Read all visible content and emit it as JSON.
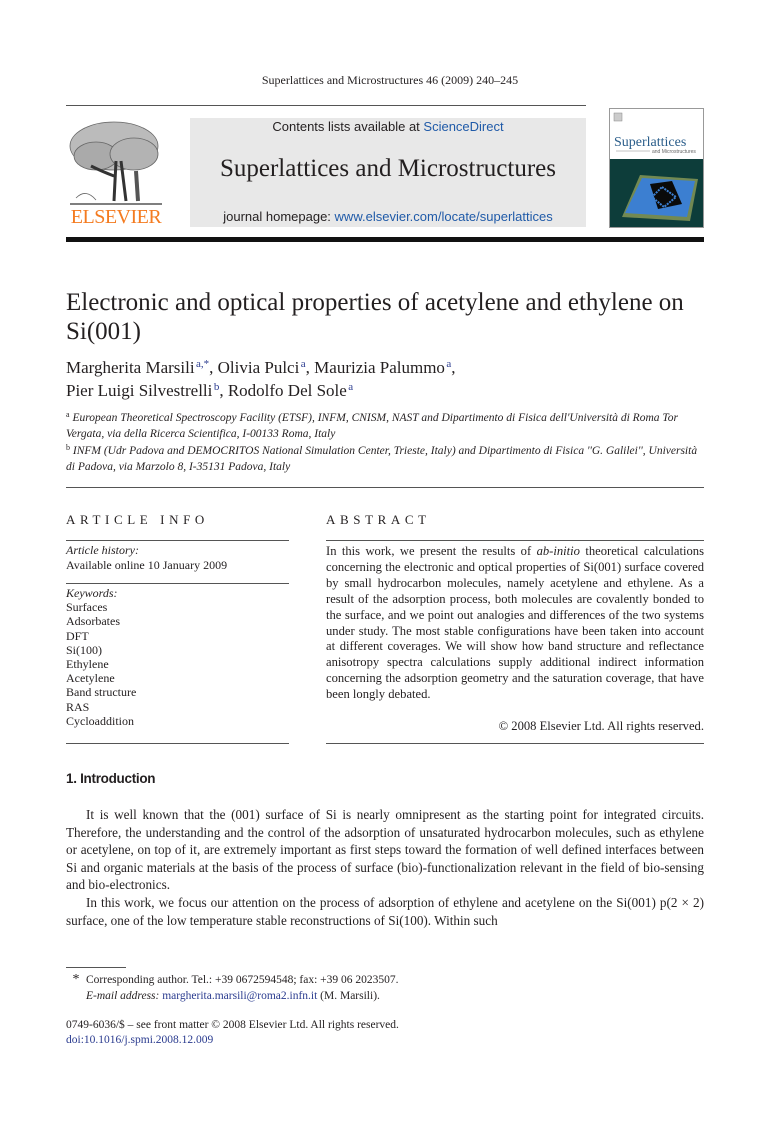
{
  "running_head": "Superlattices and Microstructures 46 (2009) 240–245",
  "masthead": {
    "publisher_logo_text": "ELSEVIER",
    "contents_prefix": "Contents lists available at ",
    "contents_link": "ScienceDirect",
    "journal_name": "Superlattices and Microstructures",
    "homepage_prefix": "journal homepage: ",
    "homepage_link": "www.elsevier.com/locate/superlattices",
    "cover_title": "Superlattices",
    "cover_subtitle": "and Microstructures"
  },
  "article": {
    "title": "Electronic and optical properties of acetylene and ethylene on Si(001)",
    "authors": [
      {
        "name": "Margherita Marsili",
        "aff": "a,*"
      },
      {
        "name": "Olivia Pulci",
        "aff": "a"
      },
      {
        "name": "Maurizia Palummo",
        "aff": "a"
      },
      {
        "name": "Pier Luigi Silvestrelli",
        "aff": "b"
      },
      {
        "name": "Rodolfo Del Sole",
        "aff": "a"
      }
    ],
    "affiliations": [
      {
        "mark": "a",
        "text": "European Theoretical Spectroscopy Facility (ETSF), INFM, CNISM, NAST and Dipartimento di Fisica dell'Università di Roma Tor Vergata, via della Ricerca Scientifica, I-00133 Roma, Italy"
      },
      {
        "mark": "b",
        "text": "INFM (Udr Padova and DEMOCRITOS National Simulation Center, Trieste, Italy) and Dipartimento di Fisica ''G. Galilei'', Università di Padova, via Marzolo 8, I-35131 Padova, Italy"
      }
    ]
  },
  "article_info": {
    "heading": "ARTICLE INFO",
    "history_label": "Article history:",
    "history_value": "Available online 10 January 2009",
    "keywords_label": "Keywords:",
    "keywords": [
      "Surfaces",
      "Adsorbates",
      "DFT",
      "Si(100)",
      "Ethylene",
      "Acetylene",
      "Band structure",
      "RAS",
      "Cycloaddition"
    ]
  },
  "abstract": {
    "heading": "ABSTRACT",
    "text_before_italic": "In this work, we present the results of ",
    "italic": "ab-initio",
    "text_after_italic": " theoretical calculations concerning the electronic and optical properties of Si(001) surface covered by small hydrocarbon molecules, namely acetylene and ethylene. As a result of the adsorption process, both molecules are covalently bonded to the surface, and we point out analogies and differences of the two systems under study. The most stable configurations have been taken into account at different coverages. We will show how band structure and reflectance anisotropy spectra calculations supply additional indirect information concerning the adsorption geometry and the saturation coverage, that have been longly debated.",
    "copyright": "© 2008 Elsevier Ltd. All rights reserved."
  },
  "introduction": {
    "heading": "1.  Introduction",
    "paragraphs": [
      "It is well known that the (001) surface of Si is nearly omnipresent as the starting point for integrated circuits. Therefore, the understanding and the control of the adsorption of unsaturated hydrocarbon molecules, such as ethylene or acetylene, on top of it, are extremely important as first steps toward the formation of well defined interfaces between Si and organic materials at the basis of the process of surface (bio)-functionalization relevant in the field of bio-sensing and bio-electronics.",
      "In this work, we focus our attention on the process of adsorption of ethylene and acetylene on the Si(001) p(2 × 2) surface, one of the low temperature stable reconstructions of Si(100). Within such"
    ]
  },
  "footnote": {
    "mark": "*",
    "corresponding": "Corresponding author. Tel.: +39 0672594548; fax: +39 06 2023507.",
    "email_label": "E-mail address:",
    "email": "margherita.marsili@roma2.infn.it",
    "email_suffix": " (M. Marsili)."
  },
  "front_matter": {
    "issn_line": "0749-6036/$ – see front matter © 2008 Elsevier Ltd. All rights reserved.",
    "doi": "doi:10.1016/j.spmi.2008.12.009"
  }
}
